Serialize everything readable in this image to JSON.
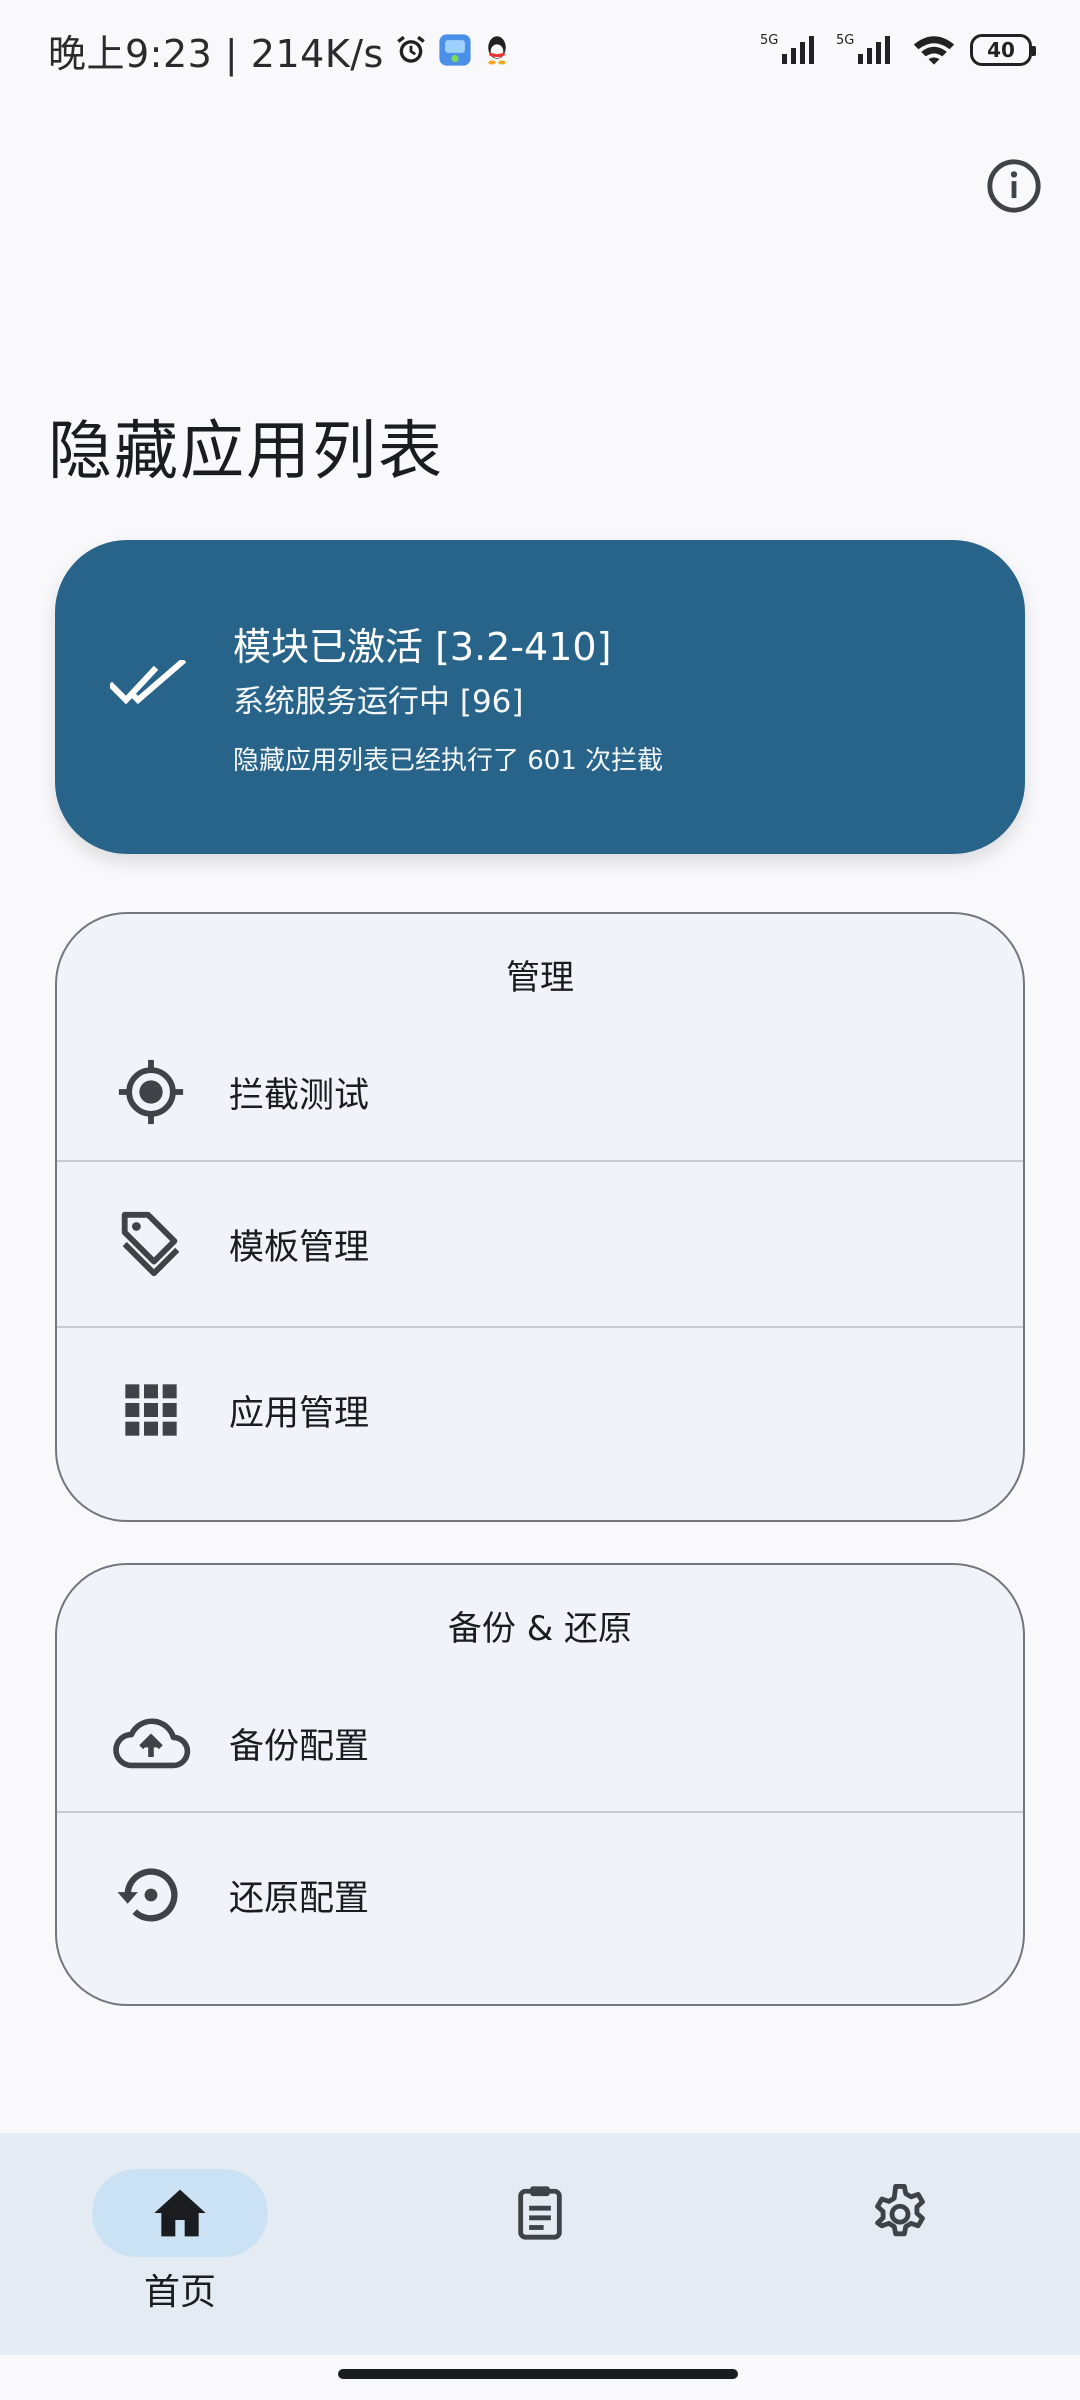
{
  "status_bar": {
    "time_speed": "晚上9:23 | 214K/s",
    "network_1": "5G",
    "network_2": "5G",
    "battery": "40"
  },
  "header": {
    "title": "隐藏应用列表"
  },
  "status_card": {
    "line1": "模块已激活 [3.2-410]",
    "line2": "系统服务运行中 [96]",
    "line3": "隐藏应用列表已经执行了 601 次拦截",
    "color": "#286489"
  },
  "manage_section": {
    "title": "管理",
    "items": [
      {
        "label": "拦截测试",
        "icon": "crosshair-icon"
      },
      {
        "label": "模板管理",
        "icon": "tag-icon"
      },
      {
        "label": "应用管理",
        "icon": "apps-grid-icon"
      }
    ]
  },
  "backup_section": {
    "title": "备份 & 还原",
    "items": [
      {
        "label": "备份配置",
        "icon": "cloud-upload-icon"
      },
      {
        "label": "还原配置",
        "icon": "restore-icon"
      }
    ]
  },
  "bottom_nav": {
    "items": [
      {
        "label": "首页",
        "icon": "home-icon",
        "active": true
      },
      {
        "label": "",
        "icon": "clipboard-icon",
        "active": false
      },
      {
        "label": "",
        "icon": "gear-icon",
        "active": false
      }
    ]
  }
}
